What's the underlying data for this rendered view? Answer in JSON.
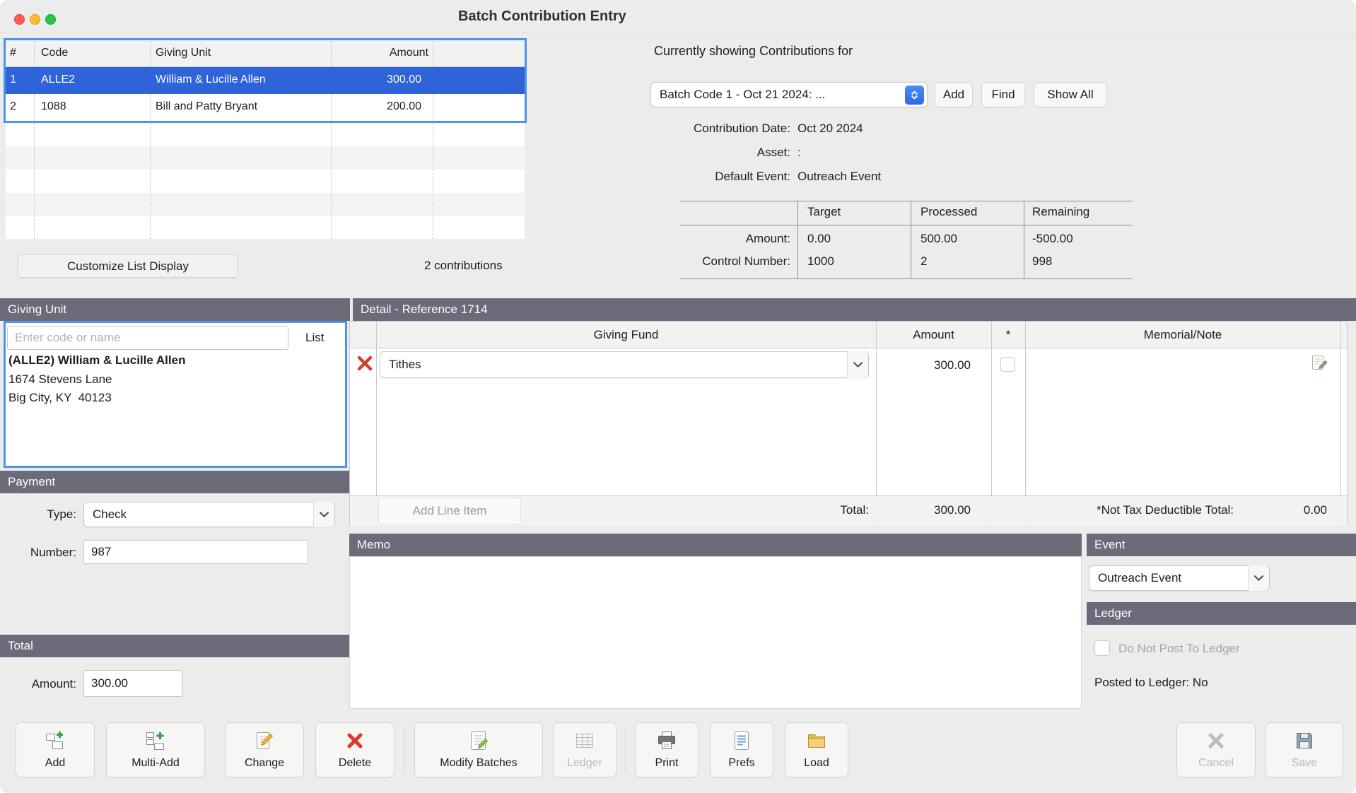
{
  "window": {
    "title": "Batch Contribution Entry"
  },
  "contribution_list": {
    "columns": {
      "num": "#",
      "code": "Code",
      "giving_unit": "Giving Unit",
      "amount": "Amount"
    },
    "rows": [
      {
        "num": "1",
        "code": "ALLE2",
        "giving_unit": "William & Lucille Allen",
        "amount": "300.00"
      },
      {
        "num": "2",
        "code": "1088",
        "giving_unit": "Bill and Patty Bryant",
        "amount": "200.00"
      }
    ],
    "customize_button": "Customize List Display",
    "count_text": "2 contributions"
  },
  "batch_panel": {
    "heading": "Currently showing Contributions for",
    "batch_select": "Batch Code 1 - Oct 21 2024: ...",
    "add_button": "Add",
    "find_button": "Find",
    "show_all_button": "Show All",
    "fields": [
      {
        "label": "Contribution Date:",
        "value": "Oct 20 2024"
      },
      {
        "label": "Asset:",
        "value": ":"
      },
      {
        "label": "Default Event:",
        "value": "Outreach Event"
      }
    ],
    "stats": {
      "columns": [
        "Target",
        "Processed",
        "Remaining"
      ],
      "rows": [
        {
          "label": "Amount:",
          "target": "0.00",
          "processed": "500.00",
          "remaining": "-500.00"
        },
        {
          "label": "Control Number:",
          "target": "1000",
          "processed": "2",
          "remaining": "998"
        }
      ]
    }
  },
  "giving_unit": {
    "title": "Giving Unit",
    "search_placeholder": "Enter code or name",
    "list_button": "List",
    "name": "(ALLE2) William & Lucille Allen",
    "address1": "1674 Stevens Lane",
    "address2": "Big City, KY  40123"
  },
  "payment": {
    "title": "Payment",
    "type_label": "Type:",
    "type_value": "Check",
    "number_label": "Number:",
    "number_value": "987"
  },
  "total_section": {
    "title": "Total",
    "amount_label": "Amount:",
    "amount_value": "300.00"
  },
  "detail": {
    "title": "Detail - Reference 1714",
    "columns": {
      "fund": "Giving Fund",
      "amount": "Amount",
      "star": "*",
      "memo": "Memorial/Note"
    },
    "rows": [
      {
        "fund": "Tithes",
        "amount": "300.00"
      }
    ],
    "add_line_item": "Add Line Item",
    "total_label": "Total:",
    "total_value": "300.00",
    "ntd_label": "*Not Tax Deductible Total:",
    "ntd_value": "0.00"
  },
  "memo_section": {
    "title": "Memo",
    "value": ""
  },
  "event_section": {
    "title": "Event",
    "value": "Outreach Event"
  },
  "ledger_section": {
    "title": "Ledger",
    "checkbox_label": "Do Not Post To Ledger",
    "posted_label": "Posted to Ledger: No"
  },
  "toolbar": {
    "buttons": [
      {
        "label": "Add"
      },
      {
        "label": "Multi-Add"
      },
      {
        "label": "Change"
      },
      {
        "label": "Delete"
      },
      {
        "label": "Modify Batches"
      },
      {
        "label": "Ledger"
      },
      {
        "label": "Print"
      },
      {
        "label": "Prefs"
      },
      {
        "label": "Load"
      },
      {
        "label": "Cancel"
      },
      {
        "label": "Save"
      }
    ]
  },
  "colors": {
    "accent_blue": "#4a94ea",
    "selection_blue": "#2e63d9",
    "section_bar": "#6b6b7a"
  }
}
